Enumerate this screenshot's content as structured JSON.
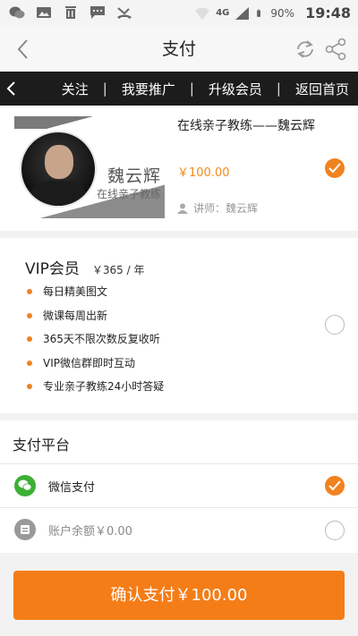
{
  "status_bar": {
    "time": "19:48",
    "battery": "90%",
    "network": "4G",
    "icons": [
      "wechat-icon",
      "image-icon",
      "trash-icon",
      "message-icon",
      "missed-call-icon",
      "wifi-icon",
      "signal-icon",
      "battery-icon"
    ]
  },
  "header": {
    "title": "支付"
  },
  "nav": {
    "links": [
      "关注",
      "我要推广",
      "升级会员",
      "返回首页"
    ],
    "separator": "|"
  },
  "course": {
    "title": "在线亲子教练——魏云辉",
    "price": "￥100.00",
    "teacher": "讲师：魏云辉",
    "cover_name": "魏云辉",
    "cover_subtitle": "在线亲子教练",
    "selected": true
  },
  "vip": {
    "title": "VIP会员",
    "price": "￥365 / 年",
    "benefits": [
      "每日精美图文",
      "微课每周出新",
      "365天不限次数反复收听",
      "VIP微信群即时互动",
      "专业亲子教练24小时答疑"
    ],
    "selected": false
  },
  "payment": {
    "title": "支付平台",
    "methods": [
      {
        "label": "微信支付",
        "selected": true
      },
      {
        "label": "账户余额￥0.00",
        "selected": false
      }
    ]
  },
  "confirm_button": {
    "label": "确认支付￥100.00"
  },
  "colors": {
    "accent": "#f47d18",
    "check": "#f08220",
    "wechat": "#3cb034",
    "navbar": "#1c1c1c"
  }
}
